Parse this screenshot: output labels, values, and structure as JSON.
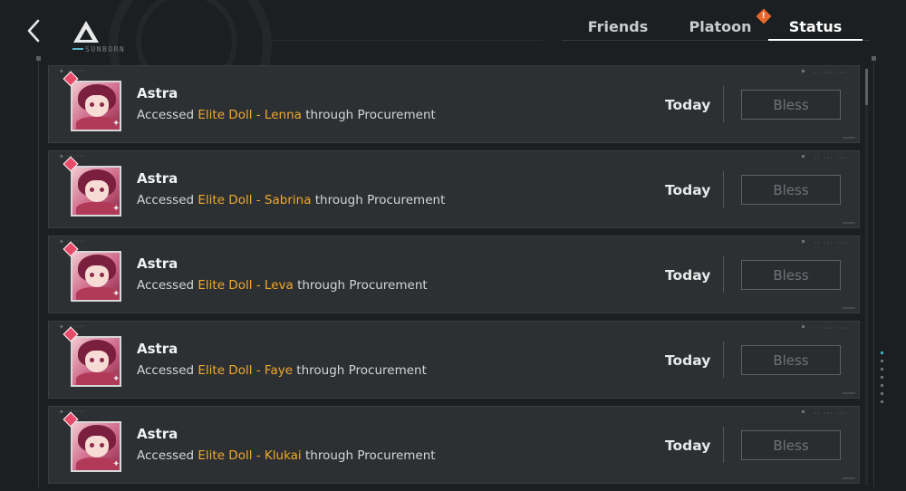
{
  "header": {
    "brand_text": "SUNBORN",
    "tabs": [
      {
        "label": "Friends",
        "selected": false
      },
      {
        "label": "Platoon",
        "selected": false,
        "badge": "!"
      },
      {
        "label": "Status",
        "selected": true
      }
    ]
  },
  "feed": {
    "items": [
      {
        "user": "Astra",
        "prefix": "Accessed ",
        "highlight": "Elite Doll - Lenna",
        "suffix": " through Procurement",
        "when": "Today",
        "action": "Bless"
      },
      {
        "user": "Astra",
        "prefix": "Accessed ",
        "highlight": "Elite Doll - Sabrina",
        "suffix": " through Procurement",
        "when": "Today",
        "action": "Bless"
      },
      {
        "user": "Astra",
        "prefix": "Accessed ",
        "highlight": "Elite Doll - Leva",
        "suffix": " through Procurement",
        "when": "Today",
        "action": "Bless"
      },
      {
        "user": "Astra",
        "prefix": "Accessed ",
        "highlight": "Elite Doll - Faye",
        "suffix": " through Procurement",
        "when": "Today",
        "action": "Bless"
      },
      {
        "user": "Astra",
        "prefix": "Accessed ",
        "highlight": "Elite Doll - Klukai",
        "suffix": " through Procurement",
        "when": "Today",
        "action": "Bless"
      }
    ]
  },
  "colors": {
    "highlight": "#f0a92d",
    "badge": "#e8672b",
    "accent": "#5fb6c9"
  },
  "icons": {
    "back": "chevron-left-icon",
    "logo": "triangle-logo-icon"
  }
}
